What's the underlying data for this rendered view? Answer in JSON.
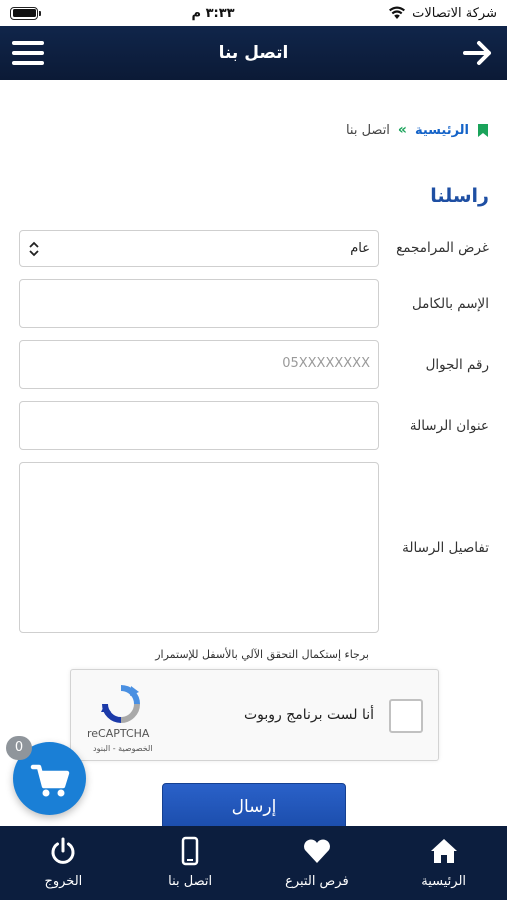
{
  "status_bar": {
    "carrier": "شركة الاتصالات",
    "time": "٣:٣٣ م",
    "battery_percent": 100
  },
  "header": {
    "title": "اتصل بنا"
  },
  "breadcrumb": {
    "home": "الرئيسية",
    "separator": "»",
    "current": "اتصل بنا"
  },
  "form": {
    "title": "راسلنا",
    "program_purpose": {
      "label": "غرض المرامجمع",
      "value": "عام"
    },
    "full_name": {
      "label": "الإسم بالكامل",
      "value": ""
    },
    "mobile": {
      "label": "رقم الجوال",
      "placeholder": "05XXXXXXXX"
    },
    "subject": {
      "label": "عنوان الرسالة",
      "value": ""
    },
    "details": {
      "label": "تفاصيل الرسالة",
      "value": ""
    },
    "recaptcha_note": "برجاء إستكمال التحقق الآلي بالأسفل للإستمرار",
    "recaptcha": {
      "label": "أنا لست برنامج روبوت",
      "brand": "reCAPTCHA",
      "terms": "الخصوصية - البنود"
    },
    "submit_label": "إرسال"
  },
  "cart": {
    "count": "0"
  },
  "tabbar": [
    {
      "label": "الرئيسية",
      "icon": "home-icon"
    },
    {
      "label": "فرص التبرع",
      "icon": "heart-icon"
    },
    {
      "label": "اتصل بنا",
      "icon": "phone-icon"
    },
    {
      "label": "الخروج",
      "icon": "power-icon"
    }
  ],
  "colors": {
    "header_bg": "#0c1e3e",
    "accent_blue": "#1e4fa3",
    "link_blue": "#1463c8",
    "bookmark_green": "#1aa35a",
    "fab_blue": "#1a7fd6"
  }
}
